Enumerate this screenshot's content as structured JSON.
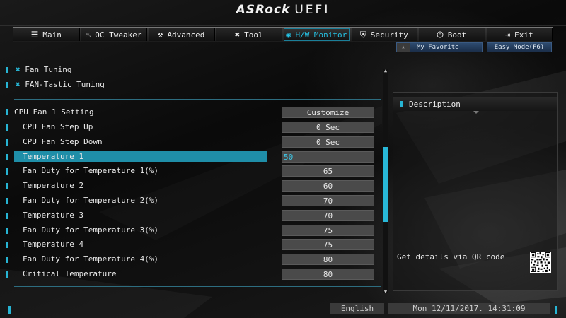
{
  "logo": {
    "brand": "ASRock",
    "suffix": "UEFI"
  },
  "nav": {
    "tabs": [
      {
        "label": "Main",
        "icon": "list-icon",
        "glyph": "☰",
        "active": false
      },
      {
        "label": "OC Tweaker",
        "icon": "flame-icon",
        "glyph": "♨",
        "active": false
      },
      {
        "label": "Advanced",
        "icon": "advanced-icon",
        "glyph": "⚒",
        "active": false
      },
      {
        "label": "Tool",
        "icon": "tools-icon",
        "glyph": "✖",
        "active": false
      },
      {
        "label": "H/W Monitor",
        "icon": "monitor-icon",
        "glyph": "◉",
        "active": true
      },
      {
        "label": "Security",
        "icon": "shield-icon",
        "glyph": "⛨",
        "active": false
      },
      {
        "label": "Boot",
        "icon": "power-icon",
        "glyph": "⏻",
        "active": false
      },
      {
        "label": "Exit",
        "icon": "exit-icon",
        "glyph": "⇥",
        "active": false
      }
    ]
  },
  "favorite": {
    "label": "My Favorite",
    "star": "★"
  },
  "easy_mode": {
    "label": "Easy Mode(F6)"
  },
  "menu": {
    "fan_tuning": "Fan Tuning",
    "fan_tastic": "FAN-Tastic Tuning",
    "cpu_fan_setting": {
      "label": "CPU Fan 1 Setting",
      "value": "Customize"
    },
    "settings": [
      {
        "label": "CPU Fan Step Up",
        "value": "0 Sec"
      },
      {
        "label": "CPU Fan Step Down",
        "value": "0 Sec"
      },
      {
        "label": "Temperature 1",
        "value": "50",
        "selected": true
      },
      {
        "label": "Fan Duty for Temperature 1(%)",
        "value": "65"
      },
      {
        "label": "Temperature 2",
        "value": "60"
      },
      {
        "label": "Fan Duty for Temperature 2(%)",
        "value": "70"
      },
      {
        "label": "Temperature 3",
        "value": "70"
      },
      {
        "label": "Fan Duty for Temperature 3(%)",
        "value": "75"
      },
      {
        "label": "Temperature 4",
        "value": "75"
      },
      {
        "label": "Fan Duty for Temperature 4(%)",
        "value": "80"
      },
      {
        "label": "Critical Temperature",
        "value": "80"
      }
    ]
  },
  "description": {
    "title": "Description",
    "qr_text": "Get details via QR code"
  },
  "bottom": {
    "language": "English",
    "datetime": "Mon 12/11/2017. 14:31:09"
  },
  "colors": {
    "accent": "#27b5d4",
    "highlight": "#1f8ea8",
    "value_bg": "#4a4a4a"
  }
}
